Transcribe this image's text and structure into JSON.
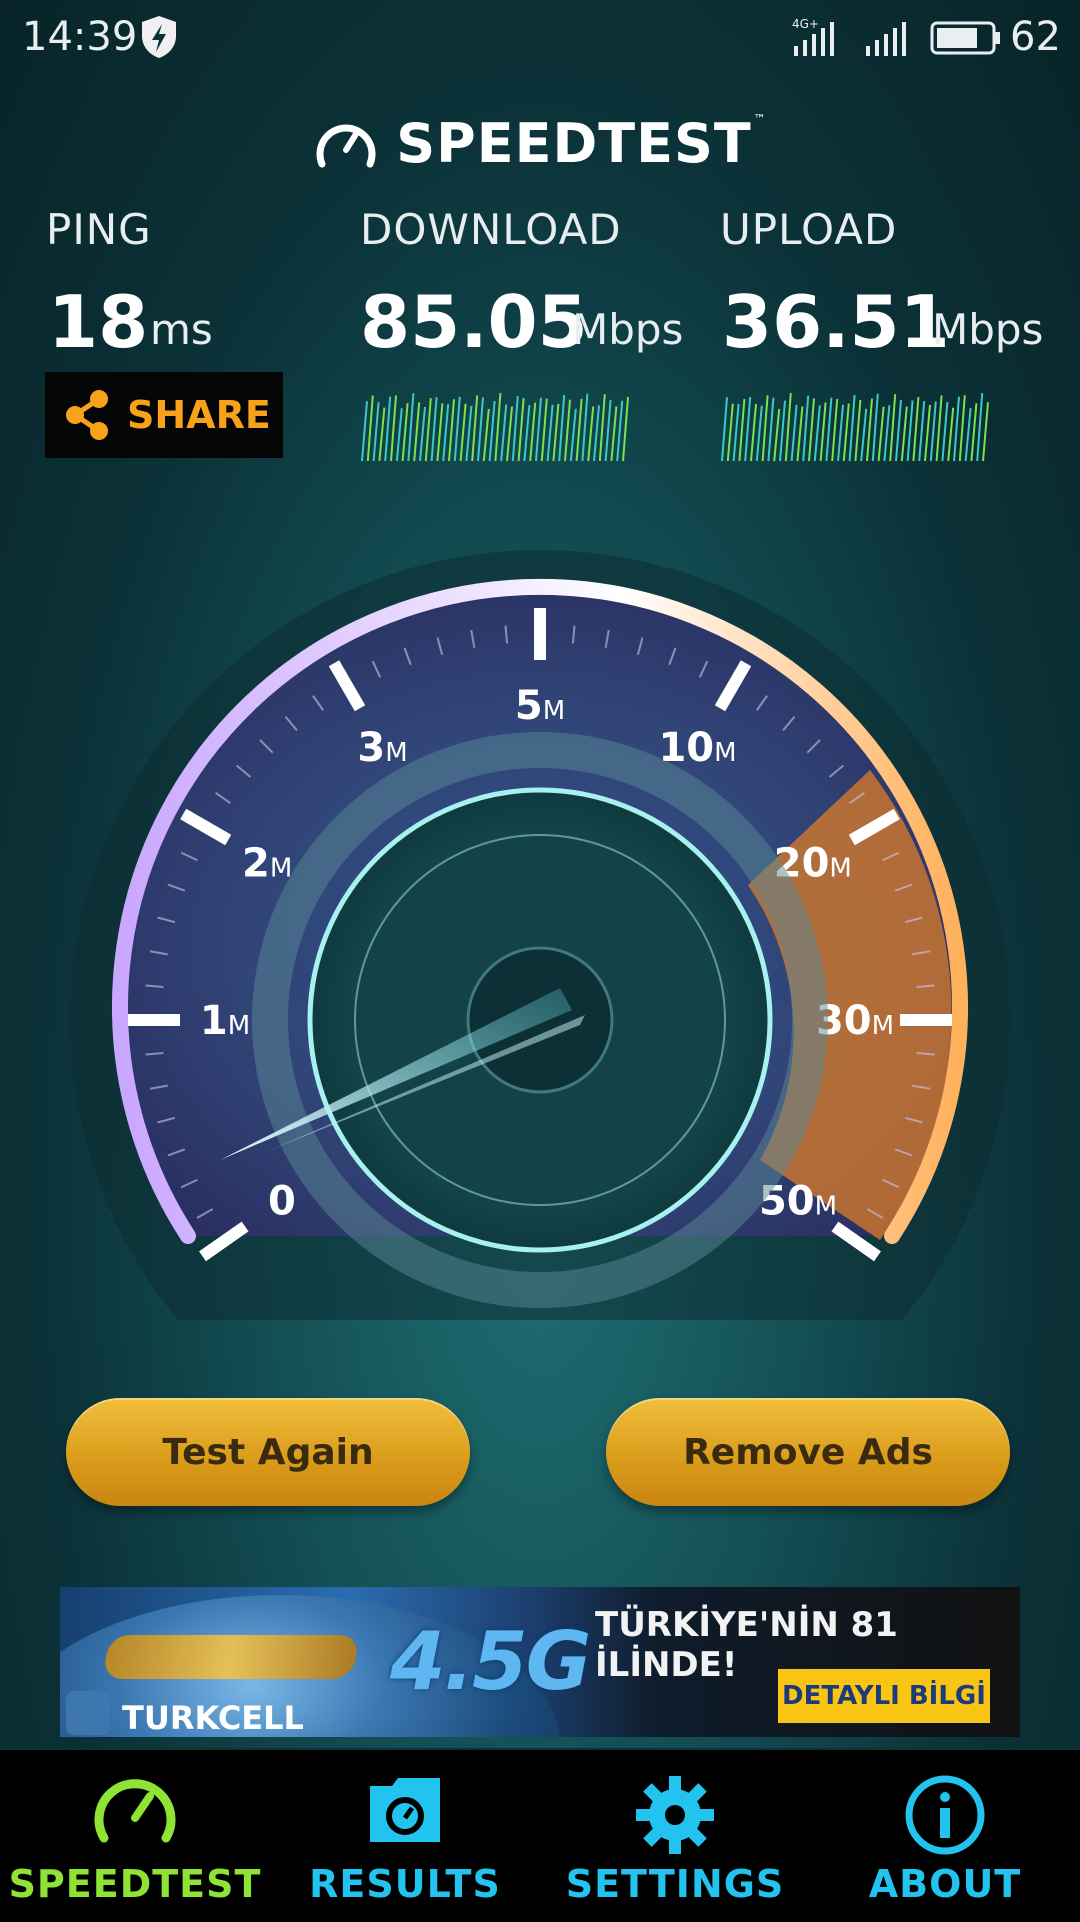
{
  "status_bar": {
    "time": "14:39",
    "network_label": "4G+",
    "battery": "62"
  },
  "brand": {
    "title": "SPEEDTEST",
    "trademark": "™"
  },
  "metrics": {
    "ping": {
      "label": "PING",
      "value": "18",
      "unit": "ms"
    },
    "download": {
      "label": "DOWNLOAD",
      "value": "85.05",
      "unit": "Mbps"
    },
    "upload": {
      "label": "UPLOAD",
      "value": "36.51",
      "unit": "Mbps"
    }
  },
  "share_label": "SHARE",
  "gauge": {
    "ticks": [
      {
        "num": "0",
        "unit": ""
      },
      {
        "num": "1",
        "unit": "M"
      },
      {
        "num": "2",
        "unit": "M"
      },
      {
        "num": "3",
        "unit": "M"
      },
      {
        "num": "5",
        "unit": "M"
      },
      {
        "num": "10",
        "unit": "M"
      },
      {
        "num": "20",
        "unit": "M"
      },
      {
        "num": "30",
        "unit": "M"
      },
      {
        "num": "50",
        "unit": "M"
      }
    ]
  },
  "buttons": {
    "test_again": "Test Again",
    "remove_ads": "Remove Ads"
  },
  "ad": {
    "logo_text": "4.5G",
    "headline": "TÜRKİYE'NİN 81 İLİNDE!",
    "cta": "DETAYLI BİLGİ",
    "brand": "TURKCELL"
  },
  "nav": {
    "items": [
      {
        "label": "SPEEDTEST",
        "icon": "gauge-icon",
        "color": "#8fe334"
      },
      {
        "label": "RESULTS",
        "icon": "results-folder-icon",
        "color": "#22c3ee"
      },
      {
        "label": "SETTINGS",
        "icon": "gear-icon",
        "color": "#22c3ee"
      },
      {
        "label": "ABOUT",
        "icon": "info-icon",
        "color": "#22c3ee"
      }
    ]
  },
  "colors": {
    "accent_green": "#8fe334",
    "accent_cyan": "#22c3ee",
    "share_orange": "#f7a21b",
    "button_gold": "#e0a224"
  }
}
